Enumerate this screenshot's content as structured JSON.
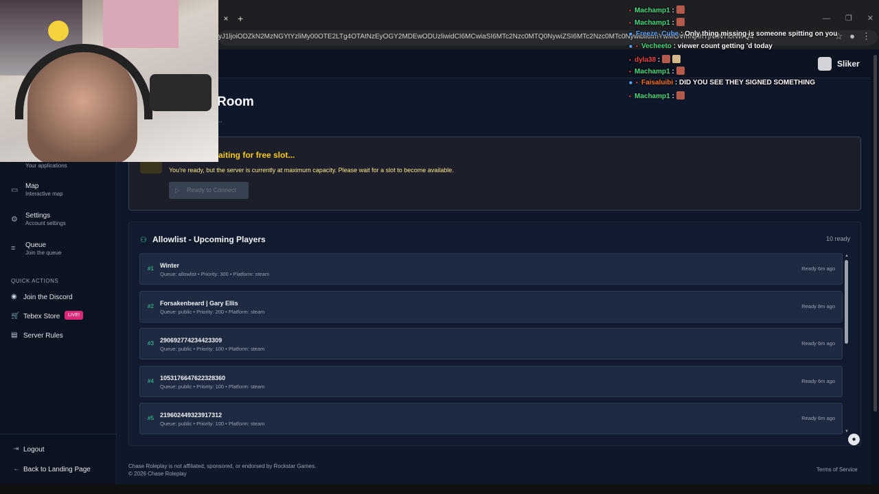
{
  "browser": {
    "tab_close": "×",
    "new_tab": "+",
    "url": "yJ1ljoiODZkN2MzNGYtYzliMy00OTE2LTg4OTAtNzEyOGY2MDEwODUzliwidCI6MCwiaSI6MTc2Nzc0MTQ0NywiZSI6MTc2Nzc0MTc0Nywibil6ImYwMGVmNjhhYjNkNTI0NWQ4ZuJlkNTJkYzQ..."
  },
  "user": {
    "name": "Sliker"
  },
  "page": {
    "title": "Room",
    "subtitle": "..."
  },
  "sidebar": {
    "apps_sub": "Your applications",
    "items": [
      {
        "title": "Map",
        "sub": "Interactive map",
        "icon": "map-icon"
      },
      {
        "title": "Settings",
        "sub": "Account settings",
        "icon": "gear-icon"
      },
      {
        "title": "Queue",
        "sub": "Join the queue",
        "icon": "list-icon"
      }
    ],
    "quick_actions_heading": "QUICK ACTIONS",
    "quick_actions": [
      {
        "label": "Join the Discord",
        "icon": "discord-icon"
      },
      {
        "label": "Tebex Store",
        "icon": "cart-icon",
        "badge": "LIVE!"
      },
      {
        "label": "Server Rules",
        "icon": "document-icon"
      }
    ],
    "footer": [
      {
        "label": "Logout",
        "icon": "logout-icon"
      },
      {
        "label": "Back to Landing Page",
        "icon": "arrow-left-icon"
      }
    ]
  },
  "waiting": {
    "title": "aiting for free slot...",
    "message": "You're ready, but the server is currently at maximum capacity. Please wait for a slot to become available.",
    "button": "Ready to Connect"
  },
  "queue": {
    "title": "Allowlist - Upcoming Players",
    "count": "10 ready",
    "rows": [
      {
        "rank": "#1",
        "name": "Winter",
        "meta": "Queue: allowlist • Priority: 300 • Platform: steam",
        "time": "Ready 6m ago"
      },
      {
        "rank": "#2",
        "name": "Forsakenbeard | Gary Ellis",
        "meta": "Queue: public • Priority: 200 • Platform: steam",
        "time": "Ready 8m ago"
      },
      {
        "rank": "#3",
        "name": "290692774234423309",
        "meta": "Queue: public • Priority: 100 • Platform: steam",
        "time": "Ready 6m ago"
      },
      {
        "rank": "#4",
        "name": "1053176647622328360",
        "meta": "Queue: public • Priority: 100 • Platform: steam",
        "time": "Ready 6m ago"
      },
      {
        "rank": "#5",
        "name": "219602449323917312",
        "meta": "Queue: public • Priority: 100 • Platform: steam",
        "time": "Ready 6m ago"
      }
    ]
  },
  "footer": {
    "disclaimer": "Chase Roleplay is not affiliated, sponsored, or endorsed by Rockstar Games.",
    "copyright": "© 2026 Chase Roleplay",
    "terms": "Terms of Service"
  },
  "chat": [
    {
      "user": "Machamp1",
      "text": ":",
      "color": "#4ade80"
    },
    {
      "user": "Machamp1",
      "text": ":",
      "color": "#4ade80"
    },
    {
      "user": "Freeze_Cube",
      "text": ": Only thing missing is someone spitting on you",
      "color": "#60a5fa"
    },
    {
      "user": "Vecheeto",
      "text": ": viewer count getting    'd today",
      "color": "#4ade80"
    },
    {
      "user": "dyla38",
      "text": ":",
      "color": "#ef4444"
    },
    {
      "user": "Machamp1",
      "text": ":",
      "color": "#4ade80"
    },
    {
      "user": "Faisaluibi",
      "text": ": DID YOU SEE THEY SIGNED SOMETHING",
      "color": "#f97316"
    },
    {
      "user": "Machamp1",
      "text": ":",
      "color": "#4ade80"
    }
  ]
}
